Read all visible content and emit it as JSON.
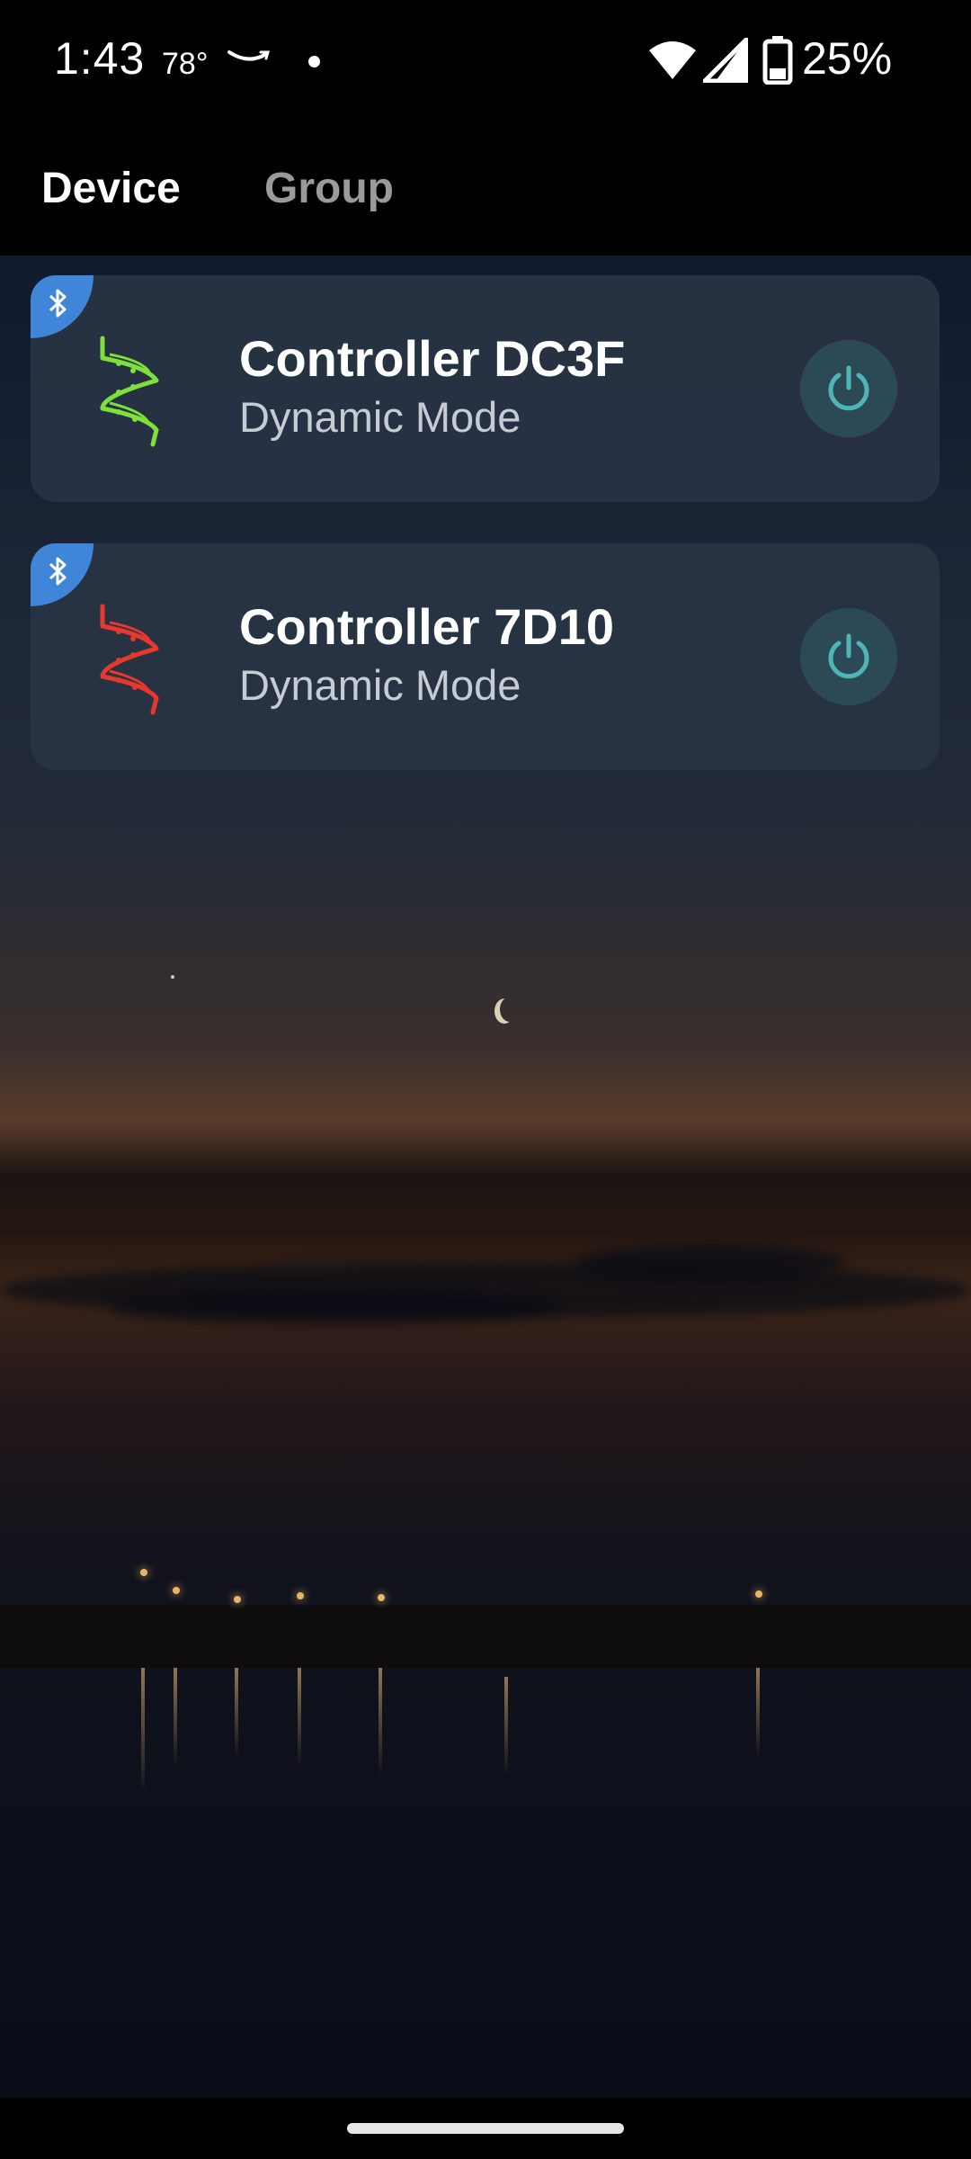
{
  "status_bar": {
    "time": "1:43",
    "temperature": "78°",
    "battery_percent": "25%",
    "icons": [
      "amazon-icon",
      "notification-dot-icon",
      "wifi-icon",
      "signal-icon",
      "battery-icon"
    ]
  },
  "tabs": [
    {
      "label": "Device",
      "active": true
    },
    {
      "label": "Group",
      "active": false
    }
  ],
  "devices": [
    {
      "name": "Controller DC3F",
      "mode": "Dynamic Mode",
      "strip_color": "#7ee03a",
      "connection": "bluetooth-icon"
    },
    {
      "name": "Controller 7D10",
      "mode": "Dynamic Mode",
      "strip_color": "#e8372c",
      "connection": "bluetooth-icon"
    }
  ],
  "colors": {
    "bluetooth_badge": "#3f86d8",
    "power_icon": "#4fb4b8",
    "card_bg": "#283444"
  }
}
